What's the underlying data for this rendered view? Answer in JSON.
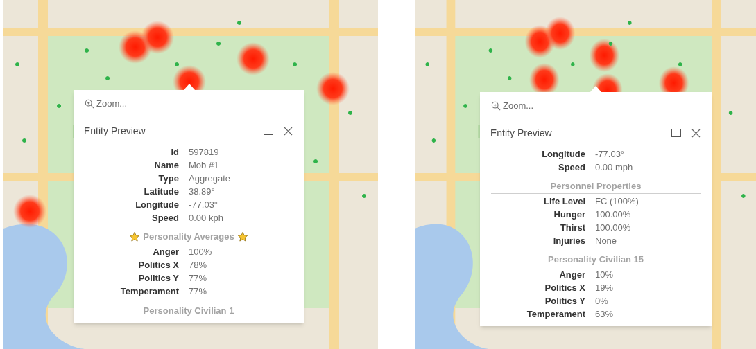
{
  "panels": [
    {
      "zoom_label": "Zoom...",
      "title": "Entity Preview",
      "blocks": [
        {
          "kind": "row",
          "label": "Id",
          "value": "597819"
        },
        {
          "kind": "row",
          "label": "Name",
          "value": "Mob #1"
        },
        {
          "kind": "row",
          "label": "Type",
          "value": "Aggregate"
        },
        {
          "kind": "row",
          "label": "Latitude",
          "value": "38.89°"
        },
        {
          "kind": "row",
          "label": "Longitude",
          "value": "-77.03°"
        },
        {
          "kind": "row",
          "label": "Speed",
          "value": "0.00 kph"
        },
        {
          "kind": "header",
          "text": "Personality Averages",
          "starred": true
        },
        {
          "kind": "row",
          "label": "Anger",
          "value": "100%"
        },
        {
          "kind": "row",
          "label": "Politics X",
          "value": "78%"
        },
        {
          "kind": "row",
          "label": "Politics Y",
          "value": "77%"
        },
        {
          "kind": "row",
          "label": "Temperament",
          "value": "77%"
        },
        {
          "kind": "header",
          "text": "Personality Civilian 1",
          "starred": false,
          "rule": false
        }
      ]
    },
    {
      "zoom_label": "Zoom...",
      "title": "Entity Preview",
      "blocks": [
        {
          "kind": "row",
          "label": "Longitude",
          "value": "-77.03°"
        },
        {
          "kind": "row",
          "label": "Speed",
          "value": "0.00 mph"
        },
        {
          "kind": "header",
          "text": "Personnel Properties",
          "starred": false
        },
        {
          "kind": "row",
          "label": "Life Level",
          "value": "FC (100%)"
        },
        {
          "kind": "row",
          "label": "Hunger",
          "value": "100.00%"
        },
        {
          "kind": "row",
          "label": "Thirst",
          "value": "100.00%"
        },
        {
          "kind": "row",
          "label": "Injuries",
          "value": "None"
        },
        {
          "kind": "header",
          "text": "Personality Civilian 15",
          "starred": false
        },
        {
          "kind": "row",
          "label": "Anger",
          "value": "10%"
        },
        {
          "kind": "row",
          "label": "Politics X",
          "value": "19%"
        },
        {
          "kind": "row",
          "label": "Politics Y",
          "value": "0%"
        },
        {
          "kind": "row",
          "label": "Temperament",
          "value": "63%"
        }
      ]
    }
  ]
}
